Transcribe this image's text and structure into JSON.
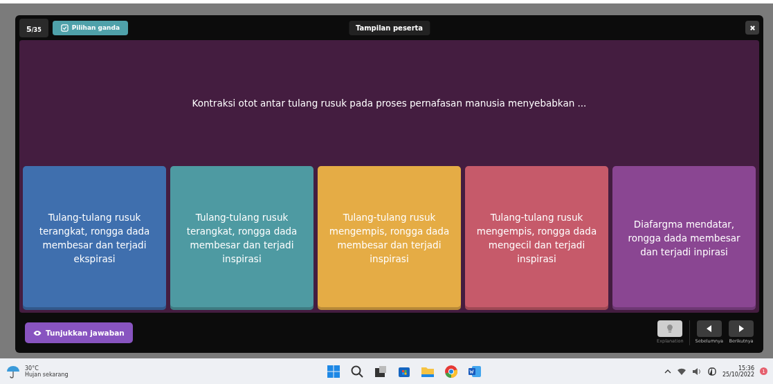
{
  "header": {
    "question_number": "5",
    "question_total": "/35",
    "question_type": "Pilihan ganda",
    "view_label": "Tampilan peserta"
  },
  "question": "Kontraksi otot antar tulang rusuk pada proses pernafasan manusia menyebabkan ...",
  "options": [
    {
      "text": "Tulang-tulang rusuk terangkat, rongga dada membesar dan terjadi ekspirasi",
      "color": "#3f6fae"
    },
    {
      "text": "Tulang-tulang rusuk terangkat, rongga dada membesar dan terjadi inspirasi",
      "color": "#4e9aa2"
    },
    {
      "text": "Tulang-tulang rusuk mengempis, rongga dada membesar dan terjadi inspirasi",
      "color": "#e5ac45"
    },
    {
      "text": "Tulang-tulang rusuk mengempis, rongga dada mengecil dan terjadi inspirasi",
      "color": "#c65a6a"
    },
    {
      "text": "Diafargma mendatar, rongga dada membesar dan terjadi inpirasi",
      "color": "#8a4692"
    }
  ],
  "footer": {
    "show_answer": "Tunjukkan jawaban",
    "explanation": {
      "label": "Explanation",
      "disabled": true
    },
    "prev": "Sebelumnya",
    "next": "Berikutnya"
  },
  "taskbar": {
    "temperature": "30°C",
    "weather": "Hujan sekarang",
    "time": "15:36",
    "date": "25/10/2022",
    "notification_count": "1"
  }
}
